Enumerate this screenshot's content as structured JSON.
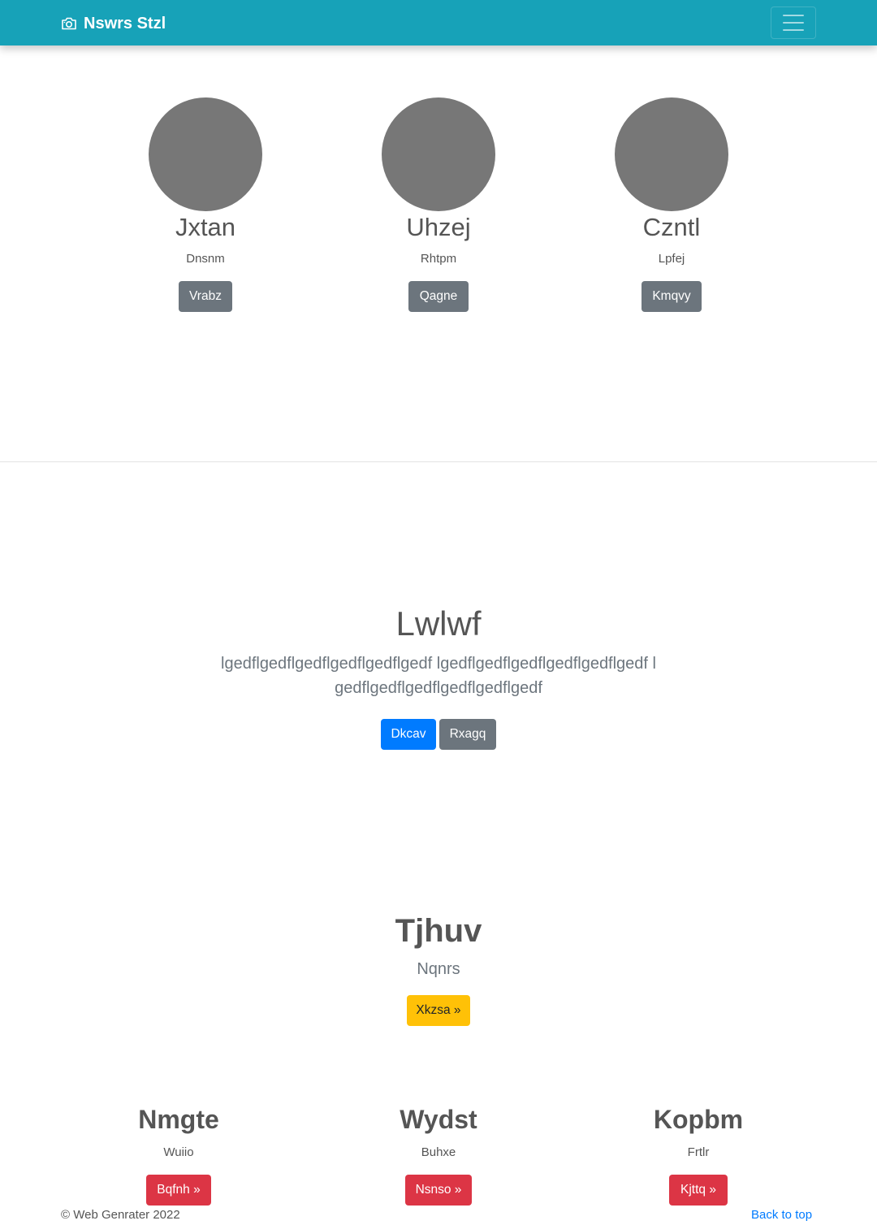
{
  "navbar": {
    "brand": "Nswrs Stzl",
    "brand_icon": "camera-icon",
    "toggler_icon": "hamburger-menu-icon",
    "color": "#17a2b8"
  },
  "team": [
    {
      "name": "Jxtan",
      "role": "Dnsnm",
      "button": "Vrabz"
    },
    {
      "name": "Uhzej",
      "role": "Rhtpm",
      "button": "Qagne"
    },
    {
      "name": "Czntl",
      "role": "Lpfej",
      "button": "Kmqvy"
    }
  ],
  "hero": {
    "title": "Lwlwf",
    "text": "lgedflgedflgedflgedflgedflgedf lgedflgedflgedflgedflgedflgedf lgedflgedflgedflgedflgedflgedf",
    "primary_button": "Dkcav",
    "secondary_button": "Rxagq"
  },
  "feature": {
    "title": "Tjhuv",
    "subtitle": "Nqnrs",
    "button": "Xkzsa »"
  },
  "columns": [
    {
      "title": "Nmgte",
      "text": "Wuiio",
      "button": "Bqfnh »"
    },
    {
      "title": "Wydst",
      "text": "Buhxe",
      "button": "Nsnso »"
    },
    {
      "title": "Kopbm",
      "text": "Frtlr",
      "button": "Kjttq »"
    }
  ],
  "footer": {
    "copyright": "© Web Genrater 2022",
    "back_to_top": "Back to top"
  },
  "colors": {
    "primary": "#007bff",
    "secondary": "#6c757d",
    "warning": "#ffc107",
    "danger": "#dc3545"
  }
}
